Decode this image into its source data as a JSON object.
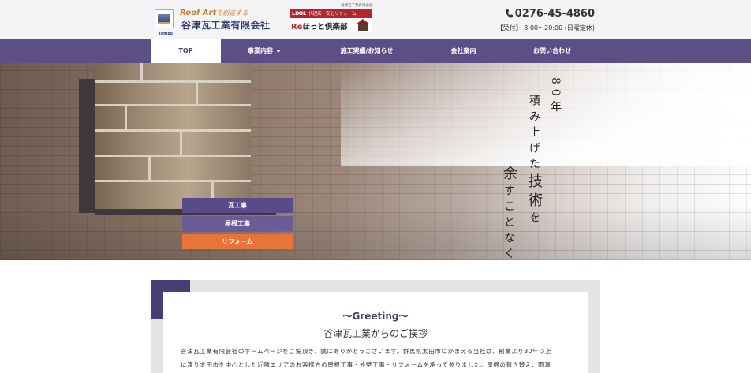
{
  "header": {
    "logo_mark_text": "Tanizu",
    "tagline_brand": "Roof Art",
    "tagline_rest": "を創造する",
    "company_name": "谷津瓦工業有限会社",
    "banner_top_brand": "LIXIL",
    "banner_top_text": "代理店　安心リフォーム",
    "banner_mini": "谷津瓦工業有限会社",
    "banner_brand_re": "Re",
    "banner_brand_jp": "ほっと倶楽部",
    "phone": "0276-45-4860",
    "hours": "【受付】 8:00～20:00 (日曜定休)"
  },
  "nav": {
    "items": [
      {
        "label": "TOP"
      },
      {
        "label": "事業内容"
      },
      {
        "label": "施工実績/お知らせ"
      },
      {
        "label": "会社案内"
      },
      {
        "label": "お問い合わせ"
      }
    ]
  },
  "hero": {
    "services": [
      {
        "label": "瓦工事",
        "color": "#5b4a8a"
      },
      {
        "label": "屋根工事",
        "color": "#6b5b97"
      },
      {
        "label": "リフォーム",
        "color": "#e8743a"
      }
    ],
    "catch_col1": "80年",
    "catch_col2": "積み上げた技術を",
    "catch_col3": "余すことなく"
  },
  "greeting": {
    "title": "～Greeting～",
    "subtitle": "谷津瓦工業からのご挨拶",
    "line1": "谷津瓦工業有限会社のホームページをご覧頂き、誠にありがとうございます。群馬県太田市にかまえる当社は、創業より80年以上",
    "line2": "に渡り太田市を中心とした近隣エリアのお客様方の屋根工事・外壁工事・リフォームを承って参りました。屋根の葺き替え、雨漏"
  },
  "colors": {
    "nav_bg": "#5c4f86",
    "accent_purple": "#4a3c74",
    "accent_orange": "#e8743a",
    "banner_red": "#b3262e"
  }
}
